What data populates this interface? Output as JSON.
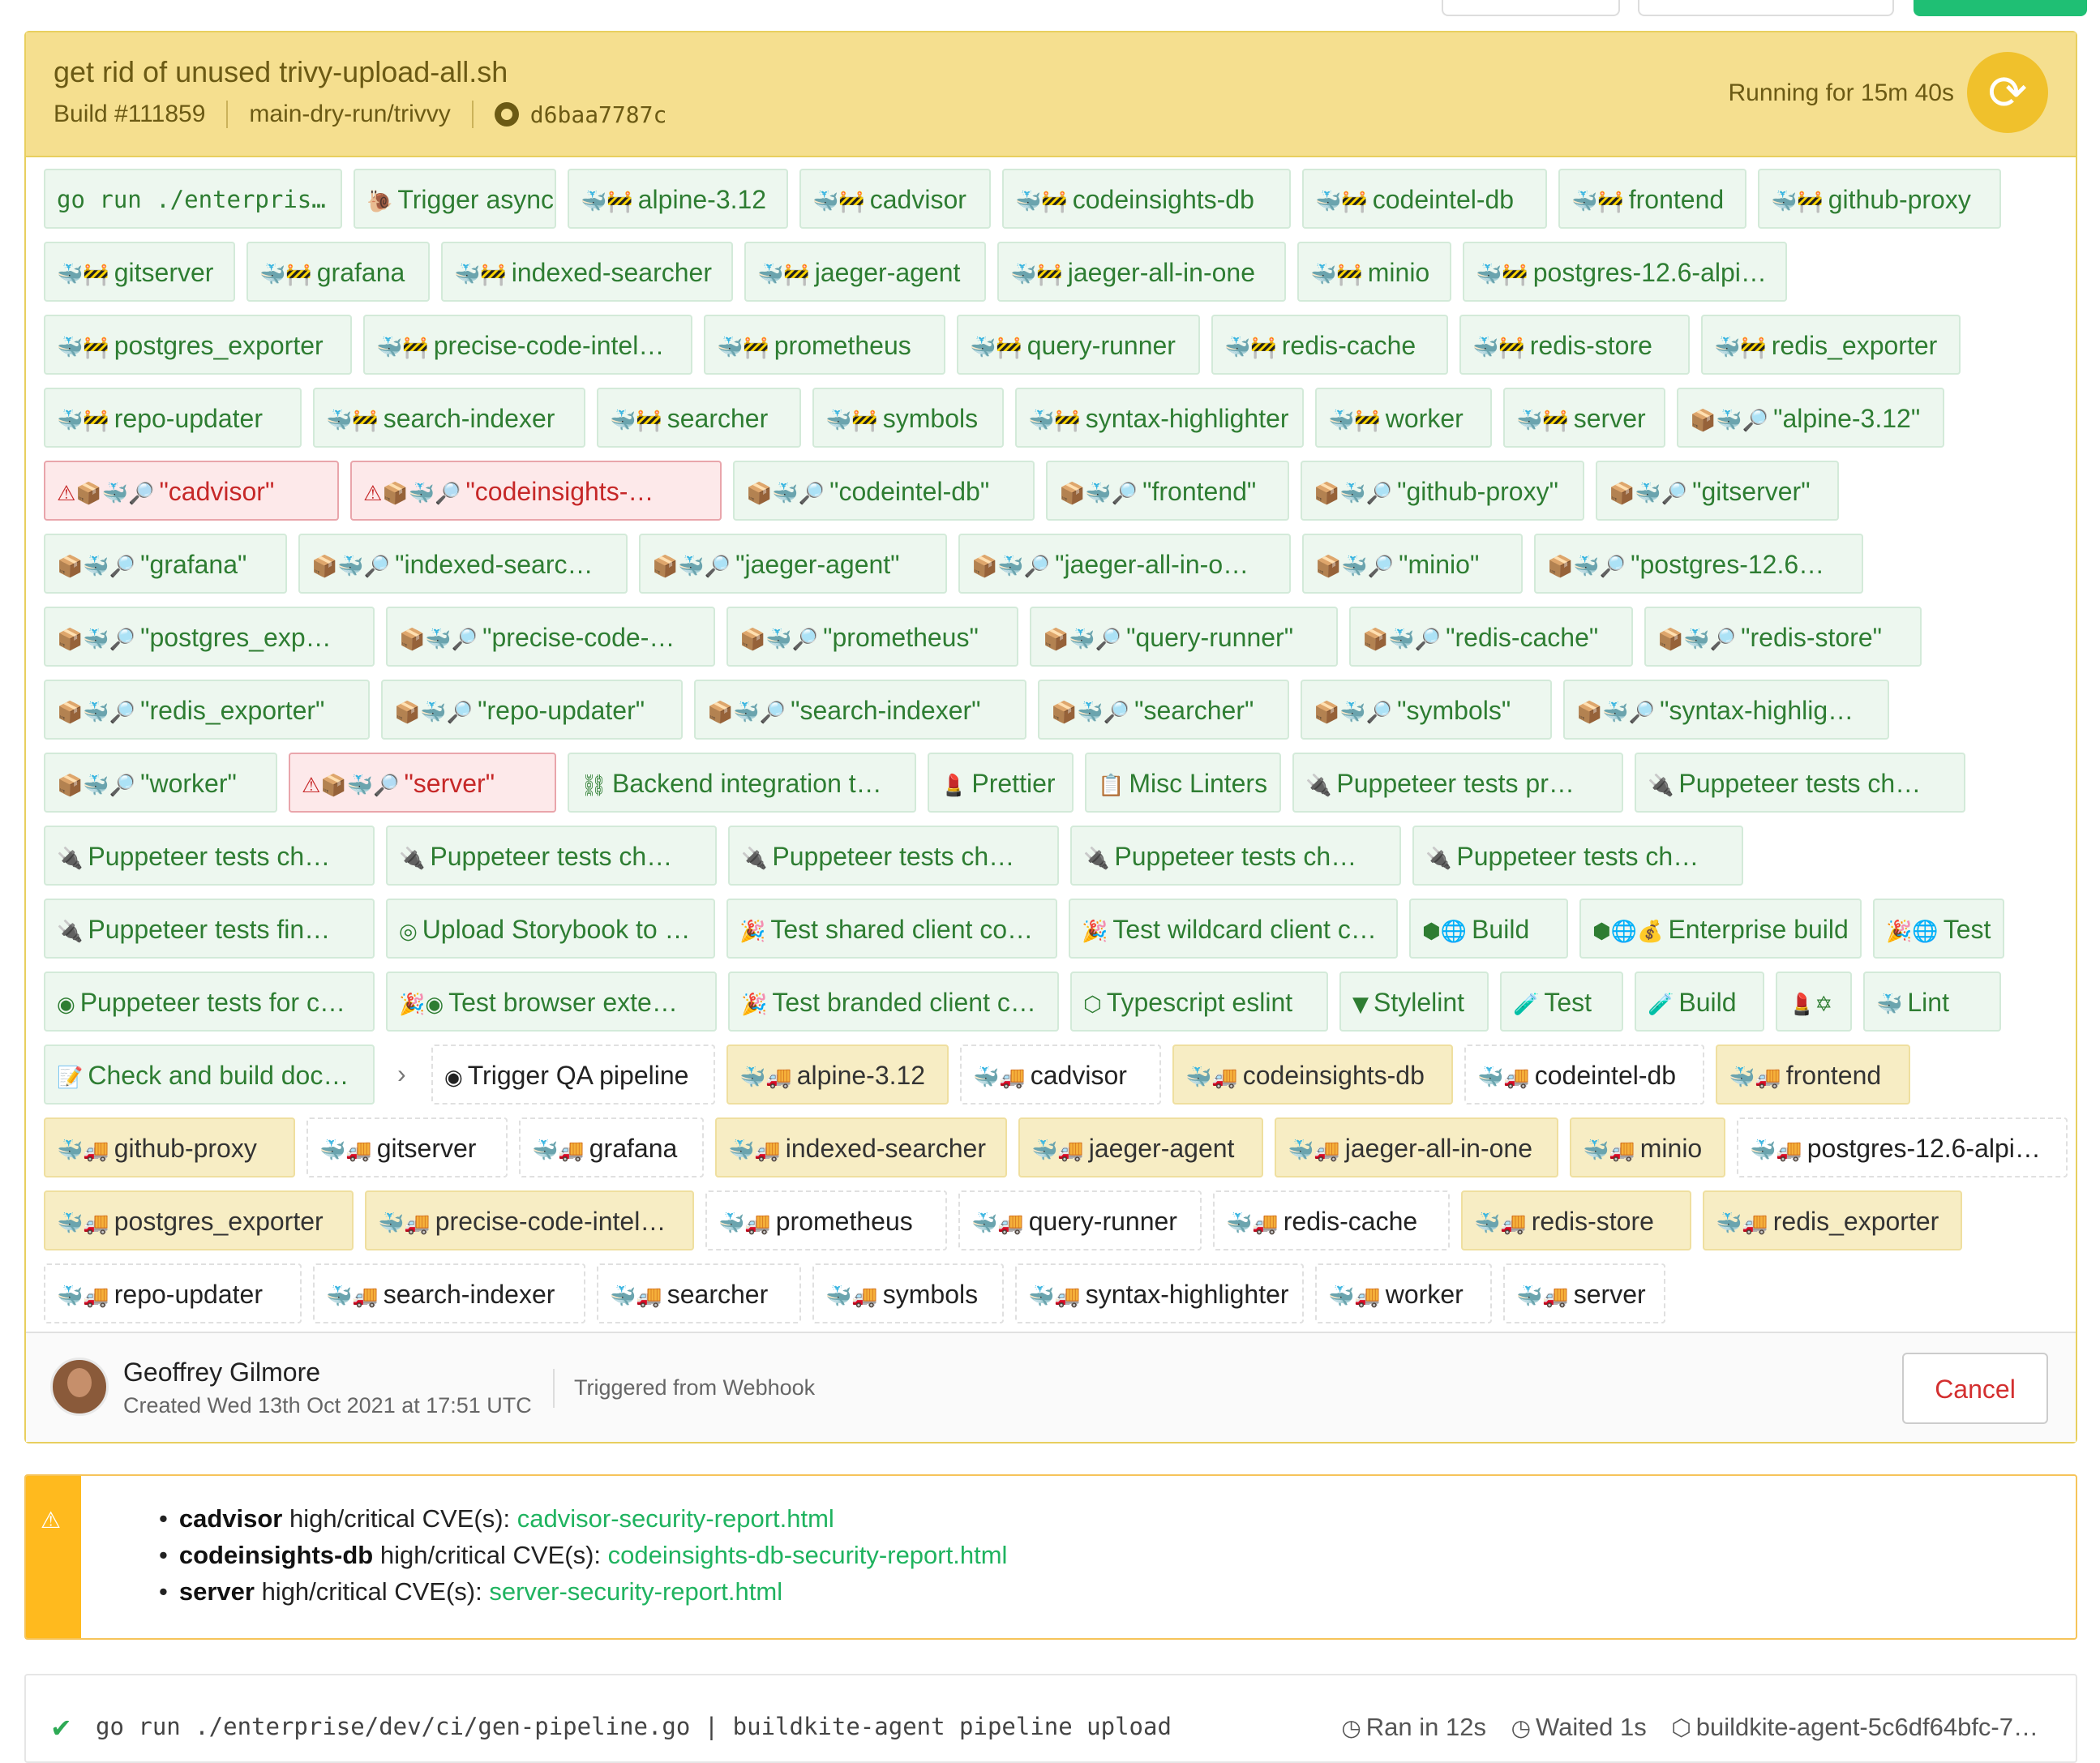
{
  "build": {
    "title": "get rid of unused trivy-upload-all.sh",
    "number": "Build #111859",
    "branch": "main-dry-run/trivvy",
    "commit": "d6baa7787c",
    "status": "Running for 15m 40s"
  },
  "jobs": [
    {
      "label": "go run ./enterpris…",
      "icon": "",
      "kind": "mono"
    },
    {
      "label": "Trigger async",
      "icon": "🐌"
    },
    {
      "label": "alpine-3.12",
      "icon": "🐳🚧"
    },
    {
      "label": "cadvisor",
      "icon": "🐳🚧"
    },
    {
      "label": "codeinsights-db",
      "icon": "🐳🚧"
    },
    {
      "label": "codeintel-db",
      "icon": "🐳🚧"
    },
    {
      "label": "frontend",
      "icon": "🐳🚧"
    },
    {
      "label": "github-proxy",
      "icon": "🐳🚧"
    },
    {
      "label": "gitserver",
      "icon": "🐳🚧"
    },
    {
      "label": "grafana",
      "icon": "🐳🚧"
    },
    {
      "label": "indexed-searcher",
      "icon": "🐳🚧"
    },
    {
      "label": "jaeger-agent",
      "icon": "🐳🚧"
    },
    {
      "label": "jaeger-all-in-one",
      "icon": "🐳🚧"
    },
    {
      "label": "minio",
      "icon": "🐳🚧"
    },
    {
      "label": "postgres-12.6-alpi…",
      "icon": "🐳🚧"
    },
    {
      "label": "postgres_exporter",
      "icon": "🐳🚧"
    },
    {
      "label": "precise-code-intel…",
      "icon": "🐳🚧"
    },
    {
      "label": "prometheus",
      "icon": "🐳🚧"
    },
    {
      "label": "query-runner",
      "icon": "🐳🚧"
    },
    {
      "label": "redis-cache",
      "icon": "🐳🚧"
    },
    {
      "label": "redis-store",
      "icon": "🐳🚧"
    },
    {
      "label": "redis_exporter",
      "icon": "🐳🚧"
    },
    {
      "label": "repo-updater",
      "icon": "🐳🚧"
    },
    {
      "label": "search-indexer",
      "icon": "🐳🚧"
    },
    {
      "label": "searcher",
      "icon": "🐳🚧"
    },
    {
      "label": "symbols",
      "icon": "🐳🚧"
    },
    {
      "label": "syntax-highlighter",
      "icon": "🐳🚧"
    },
    {
      "label": "worker",
      "icon": "🐳🚧"
    },
    {
      "label": "server",
      "icon": "🐳🚧"
    },
    {
      "label": "\"alpine-3.12\"",
      "icon": "📦🐳🔎"
    },
    {
      "label": "\"cadvisor\"",
      "icon": "⚠📦🐳🔎",
      "kind": "failed"
    },
    {
      "label": "\"codeinsights-…",
      "icon": "⚠📦🐳🔎",
      "kind": "failed"
    },
    {
      "label": "\"codeintel-db\"",
      "icon": "📦🐳🔎"
    },
    {
      "label": "\"frontend\"",
      "icon": "📦🐳🔎"
    },
    {
      "label": "\"github-proxy\"",
      "icon": "📦🐳🔎"
    },
    {
      "label": "\"gitserver\"",
      "icon": "📦🐳🔎"
    },
    {
      "label": "\"grafana\"",
      "icon": "📦🐳🔎"
    },
    {
      "label": "\"indexed-searc…",
      "icon": "📦🐳🔎"
    },
    {
      "label": "\"jaeger-agent\"",
      "icon": "📦🐳🔎"
    },
    {
      "label": "\"jaeger-all-in-o…",
      "icon": "📦🐳🔎"
    },
    {
      "label": "\"minio\"",
      "icon": "📦🐳🔎"
    },
    {
      "label": "\"postgres-12.6…",
      "icon": "📦🐳🔎"
    },
    {
      "label": "\"postgres_exp…",
      "icon": "📦🐳🔎"
    },
    {
      "label": "\"precise-code-…",
      "icon": "📦🐳🔎"
    },
    {
      "label": "\"prometheus\"",
      "icon": "📦🐳🔎"
    },
    {
      "label": "\"query-runner\"",
      "icon": "📦🐳🔎"
    },
    {
      "label": "\"redis-cache\"",
      "icon": "📦🐳🔎"
    },
    {
      "label": "\"redis-store\"",
      "icon": "📦🐳🔎"
    },
    {
      "label": "\"redis_exporter\"",
      "icon": "📦🐳🔎"
    },
    {
      "label": "\"repo-updater\"",
      "icon": "📦🐳🔎"
    },
    {
      "label": "\"search-indexer\"",
      "icon": "📦🐳🔎"
    },
    {
      "label": "\"searcher\"",
      "icon": "📦🐳🔎"
    },
    {
      "label": "\"symbols\"",
      "icon": "📦🐳🔎"
    },
    {
      "label": "\"syntax-highlig…",
      "icon": "📦🐳🔎"
    },
    {
      "label": "\"worker\"",
      "icon": "📦🐳🔎"
    },
    {
      "label": "\"server\"",
      "icon": "⚠📦🐳🔎",
      "kind": "failed"
    },
    {
      "label": "Backend integration t…",
      "icon": "⛓"
    },
    {
      "label": "Prettier",
      "icon": "💄"
    },
    {
      "label": "Misc Linters",
      "icon": "📋"
    },
    {
      "label": "Puppeteer tests pr…",
      "icon": "🔌"
    },
    {
      "label": "Puppeteer tests ch…",
      "icon": "🔌"
    },
    {
      "label": "Puppeteer tests ch…",
      "icon": "🔌"
    },
    {
      "label": "Puppeteer tests ch…",
      "icon": "🔌"
    },
    {
      "label": "Puppeteer tests ch…",
      "icon": "🔌"
    },
    {
      "label": "Puppeteer tests ch…",
      "icon": "🔌"
    },
    {
      "label": "Puppeteer tests ch…",
      "icon": "🔌"
    },
    {
      "label": "Puppeteer tests fin…",
      "icon": "🔌"
    },
    {
      "label": "Upload Storybook to …",
      "icon": "◎"
    },
    {
      "label": "Test shared client co…",
      "icon": "🎉"
    },
    {
      "label": "Test wildcard client c…",
      "icon": "🎉"
    },
    {
      "label": "Build",
      "icon": "⬢🌐"
    },
    {
      "label": "Enterprise build",
      "icon": "⬢🌐💰"
    },
    {
      "label": "Test",
      "icon": "🎉🌐"
    },
    {
      "label": "Puppeteer tests for c…",
      "icon": "◉"
    },
    {
      "label": "Test browser exte…",
      "icon": "🎉◉"
    },
    {
      "label": "Test branded client c…",
      "icon": "🎉"
    },
    {
      "label": "Typescript eslint",
      "icon": "⬡"
    },
    {
      "label": "Stylelint",
      "icon": "▼"
    },
    {
      "label": "Test",
      "icon": "🧪"
    },
    {
      "label": "Build",
      "icon": "🧪"
    },
    {
      "label": "",
      "icon": "💄✡"
    },
    {
      "label": "Lint",
      "icon": "🐳"
    },
    {
      "label": "Check and build doc…",
      "icon": "📝"
    },
    {
      "label": "›",
      "icon": "",
      "kind": "wait"
    },
    {
      "label": "Trigger QA pipeline",
      "icon": "◉",
      "kind": "plain"
    },
    {
      "label": "alpine-3.12",
      "icon": "🐳🚚",
      "kind": "upload"
    },
    {
      "label": "cadvisor",
      "icon": "🐳🚚",
      "kind": "plain"
    },
    {
      "label": "codeinsights-db",
      "icon": "🐳🚚",
      "kind": "upload"
    },
    {
      "label": "codeintel-db",
      "icon": "🐳🚚",
      "kind": "plain"
    },
    {
      "label": "frontend",
      "icon": "🐳🚚",
      "kind": "upload"
    },
    {
      "label": "github-proxy",
      "icon": "🐳🚚",
      "kind": "upload"
    },
    {
      "label": "gitserver",
      "icon": "🐳🚚",
      "kind": "plain"
    },
    {
      "label": "grafana",
      "icon": "🐳🚚",
      "kind": "plain"
    },
    {
      "label": "indexed-searcher",
      "icon": "🐳🚚",
      "kind": "upload"
    },
    {
      "label": "jaeger-agent",
      "icon": "🐳🚚",
      "kind": "upload"
    },
    {
      "label": "jaeger-all-in-one",
      "icon": "🐳🚚",
      "kind": "upload"
    },
    {
      "label": "minio",
      "icon": "🐳🚚",
      "kind": "upload"
    },
    {
      "label": "postgres-12.6-alpi…",
      "icon": "🐳🚚",
      "kind": "plain"
    },
    {
      "label": "postgres_exporter",
      "icon": "🐳🚚",
      "kind": "upload"
    },
    {
      "label": "precise-code-intel…",
      "icon": "🐳🚚",
      "kind": "upload"
    },
    {
      "label": "prometheus",
      "icon": "🐳🚚",
      "kind": "plain"
    },
    {
      "label": "query-runner",
      "icon": "🐳🚚",
      "kind": "plain"
    },
    {
      "label": "redis-cache",
      "icon": "🐳🚚",
      "kind": "plain"
    },
    {
      "label": "redis-store",
      "icon": "🐳🚚",
      "kind": "upload"
    },
    {
      "label": "redis_exporter",
      "icon": "🐳🚚",
      "kind": "upload"
    },
    {
      "label": "repo-updater",
      "icon": "🐳🚚",
      "kind": "plain"
    },
    {
      "label": "search-indexer",
      "icon": "🐳🚚",
      "kind": "plain"
    },
    {
      "label": "searcher",
      "icon": "🐳🚚",
      "kind": "plain"
    },
    {
      "label": "symbols",
      "icon": "🐳🚚",
      "kind": "plain"
    },
    {
      "label": "syntax-highlighter",
      "icon": "🐳🚚",
      "kind": "plain"
    },
    {
      "label": "worker",
      "icon": "🐳🚚",
      "kind": "plain"
    },
    {
      "label": "server",
      "icon": "🐳🚚",
      "kind": "plain"
    }
  ],
  "footer": {
    "author": "Geoffrey Gilmore",
    "created": "Created Wed 13th Oct 2021 at 17:51 UTC",
    "triggered": "Triggered from Webhook",
    "cancel_label": "Cancel"
  },
  "annotation": {
    "items": [
      {
        "name": "cadvisor",
        "text": " high/critical CVE(s): ",
        "link": "cadvisor-security-report.html"
      },
      {
        "name": "codeinsights-db",
        "text": " high/critical CVE(s): ",
        "link": "codeinsights-db-security-report.html"
      },
      {
        "name": "server",
        "text": " high/critical CVE(s): ",
        "link": "server-security-report.html"
      }
    ]
  },
  "step": {
    "check": "✔",
    "command": "go run ./enterprise/dev/ci/gen-pipeline.go | buildkite-agent pipeline upload",
    "ran": "Ran in 12s",
    "waited": "Waited 1s",
    "agent": "buildkite-agent-5c6df64bfc-7…"
  },
  "colors": {
    "header_bg": "#f5df8f",
    "passed": "#2e7d32",
    "failed": "#c62828",
    "link": "#1fb35f",
    "warning": "#ffba1e"
  }
}
